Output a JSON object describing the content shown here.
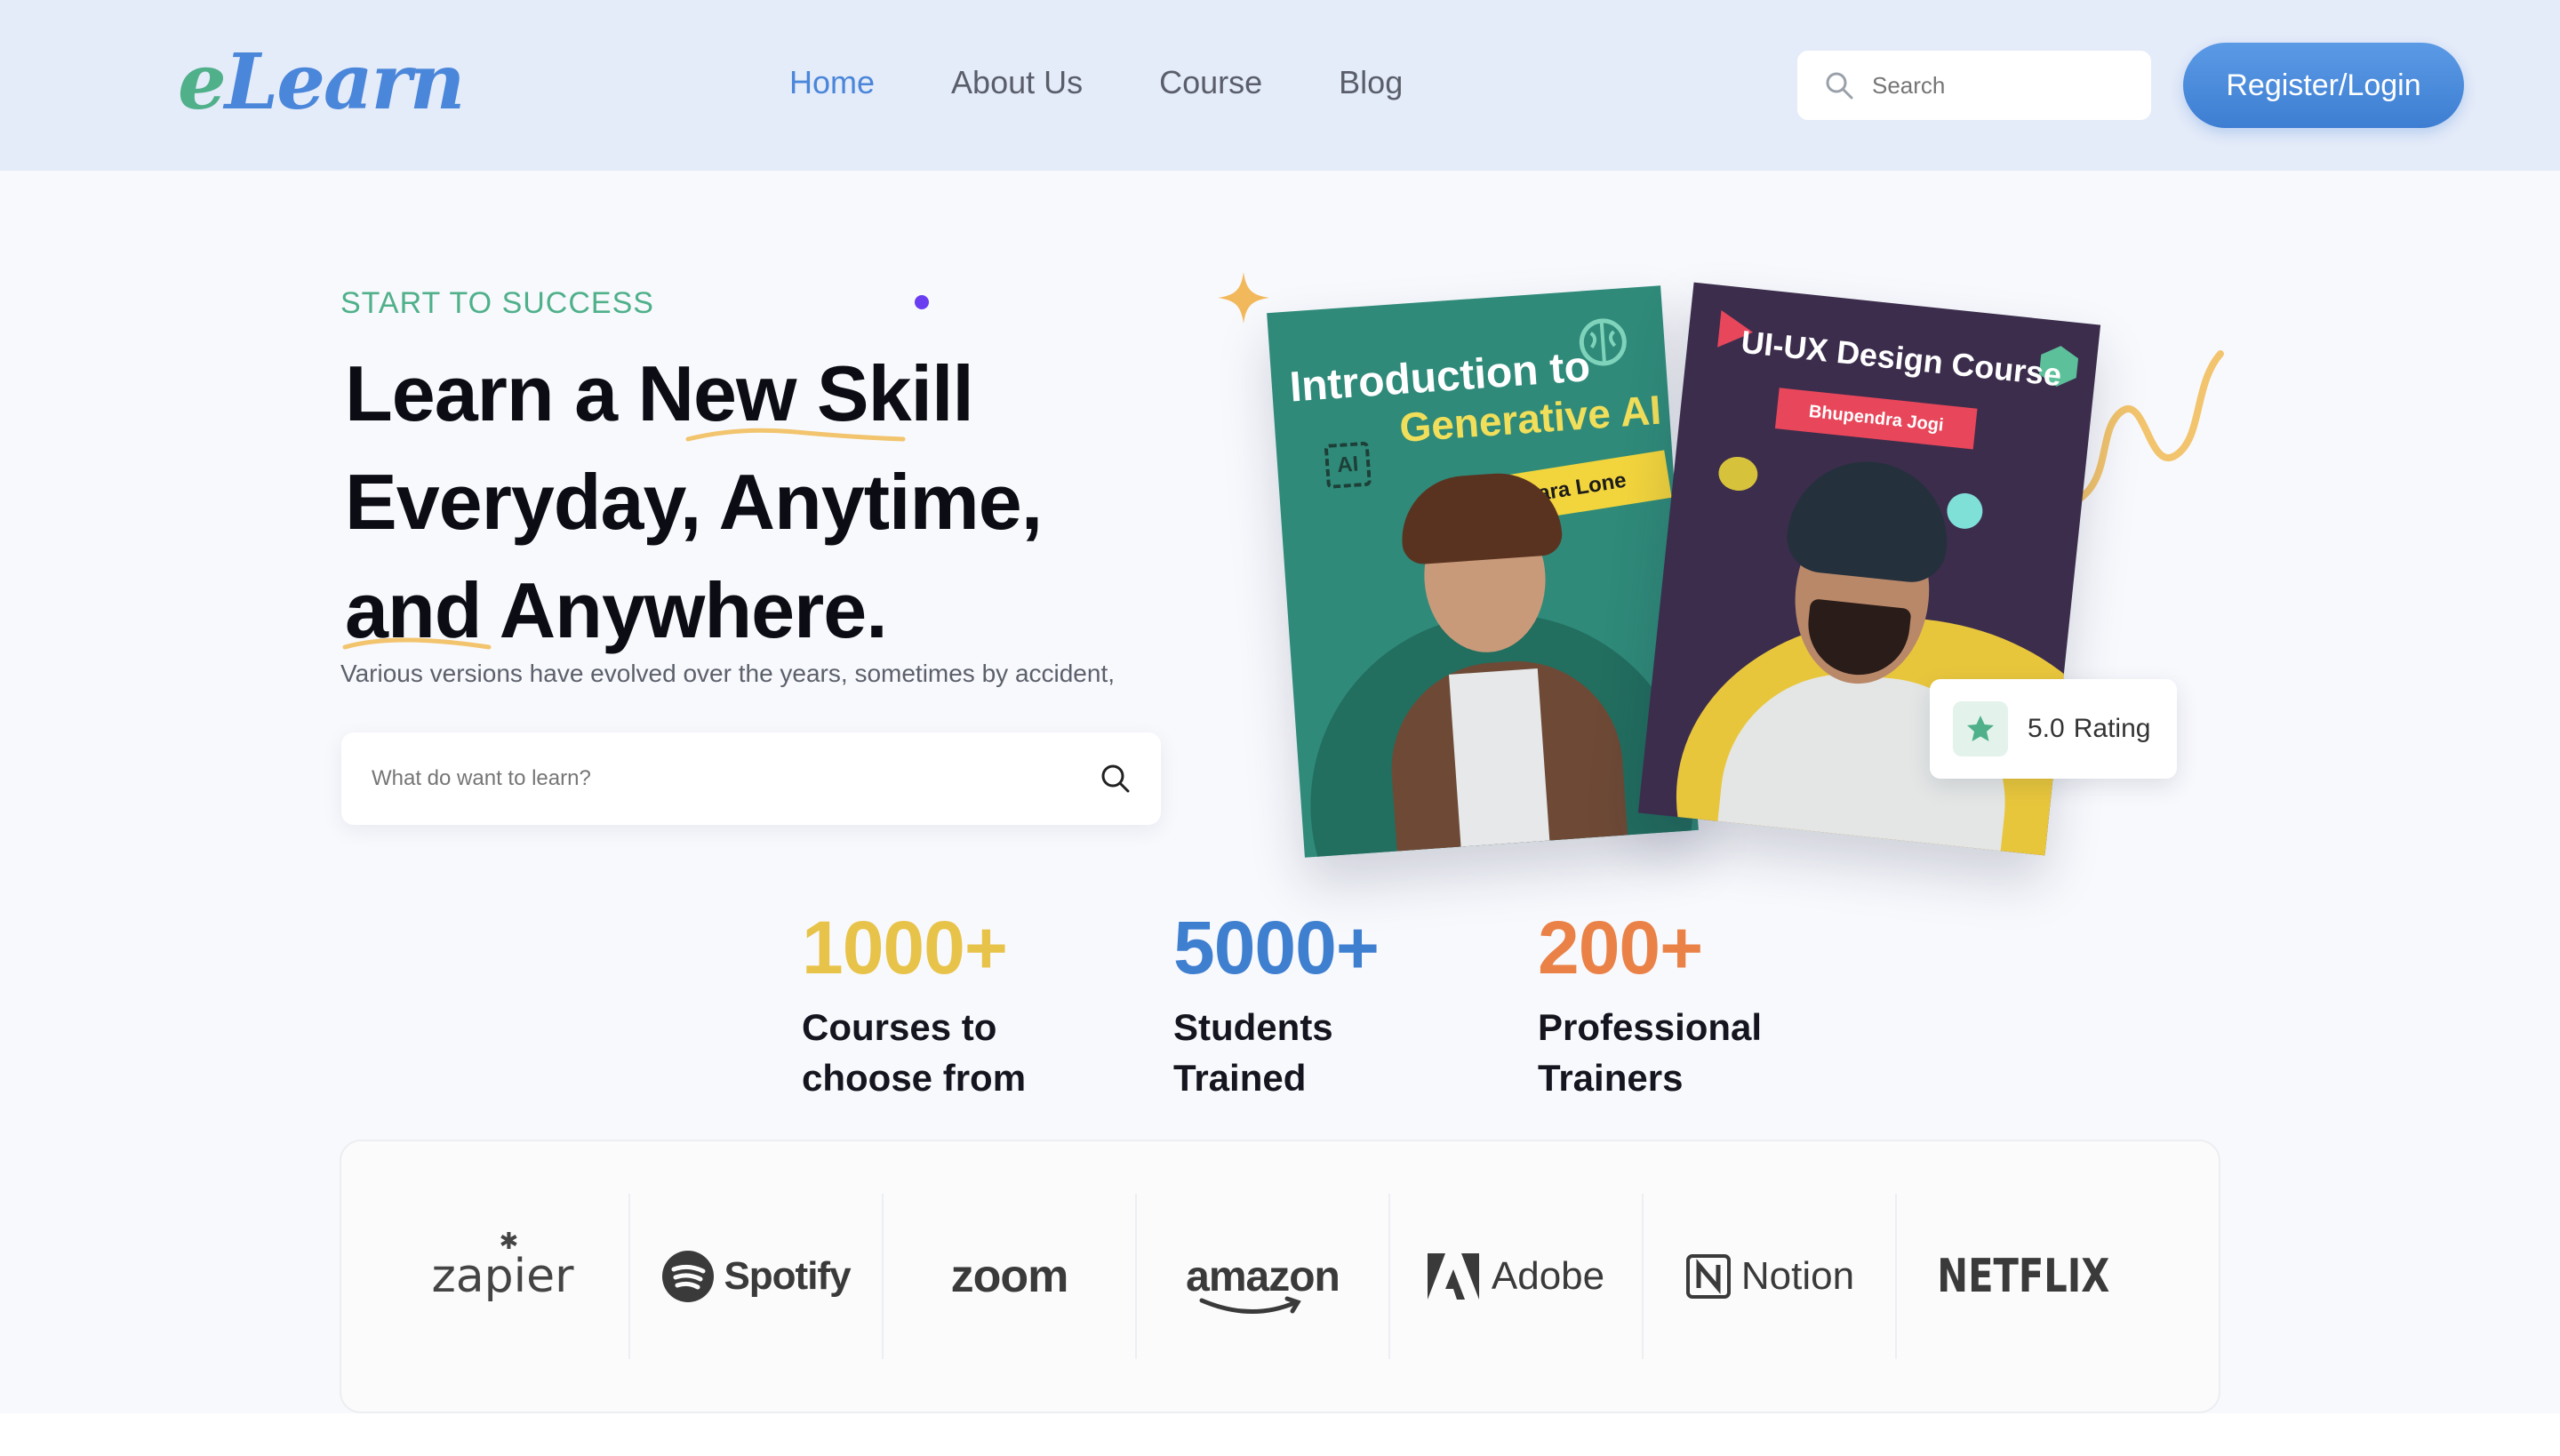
{
  "header": {
    "logo_e": "e",
    "logo_rest": "Learn",
    "nav": [
      {
        "label": "Home",
        "active": true
      },
      {
        "label": "About Us",
        "active": false
      },
      {
        "label": "Course",
        "active": false
      },
      {
        "label": "Blog",
        "active": false
      }
    ],
    "search_placeholder": "Search",
    "search_icon": "search-icon",
    "register_label": "Register/Login"
  },
  "hero": {
    "eyebrow": "START TO SUCCESS",
    "headline": [
      "Learn a New Skill",
      "Everyday, Anytime,",
      "and Anywhere."
    ],
    "subtext": "Various versions have evolved over the years, sometimes by accident,",
    "search_placeholder": "What do want to learn?",
    "search_icon": "search-icon"
  },
  "courses": [
    {
      "title_line1": "Introduction to",
      "title_line2": "Generative AI",
      "instructor": "Zara Lone",
      "badge": "AI",
      "card_color": "#2f8a79"
    },
    {
      "title": "UI-UX Design Course",
      "instructor": "Bhupendra Jogi",
      "card_color": "#3c2d4d"
    }
  ],
  "rating": {
    "value": "5.0",
    "label": "Rating",
    "icon": "star-icon"
  },
  "stats": [
    {
      "number": "1000+",
      "line1": "Courses to",
      "line2": "choose from",
      "color": "#e8c34a"
    },
    {
      "number": "5000+",
      "line1": "Students",
      "line2": "Trained",
      "color": "#3e7fd0"
    },
    {
      "number": "200+",
      "line1": "Professional",
      "line2": "Trainers",
      "color": "#ea8247"
    }
  ],
  "partners": [
    "zapier",
    "Spotify",
    "zoom",
    "amazon",
    "Adobe",
    "Notion",
    "NETFLIX"
  ],
  "colors": {
    "green": "#4fb08a",
    "blue": "#4a86d9",
    "header_bg": "#e4ebf9",
    "accent_yellow": "#f2c46d"
  }
}
